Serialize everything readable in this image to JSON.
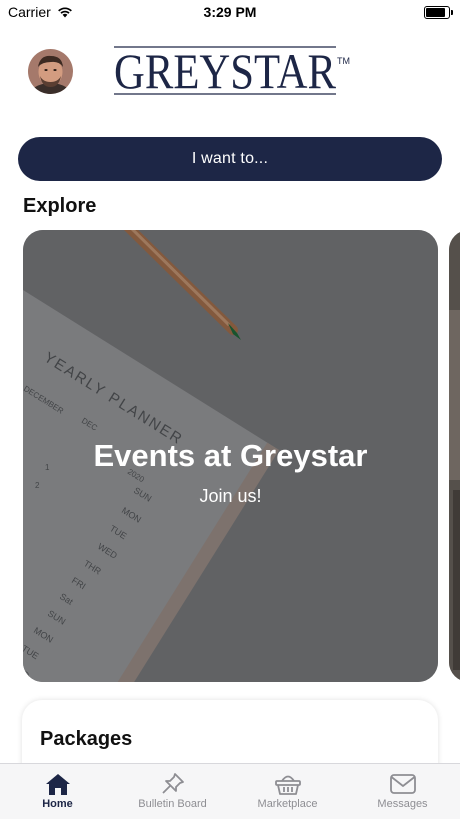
{
  "status_bar": {
    "carrier": "Carrier",
    "time": "3:29 PM",
    "battery_level": 0.95
  },
  "header": {
    "avatar_alt": "user-avatar",
    "logo_text": "GREYSTAR",
    "logo_mark": "TM"
  },
  "actions": {
    "i_want_to": "I want to..."
  },
  "explore": {
    "heading": "Explore",
    "cards": [
      {
        "title": "Events at Greystar",
        "subtitle": "Join us!"
      }
    ],
    "planner_text": {
      "title": "YEARLY PLANNER",
      "year": "2020",
      "months": [
        "DECEMBER",
        "DEC"
      ],
      "days": [
        "SUN",
        "MON",
        "TUE",
        "WED",
        "THR",
        "FRI",
        "Sat",
        "SUN",
        "MON",
        "TUE",
        "WED"
      ],
      "numbers": [
        "1",
        "2",
        "3",
        "4"
      ]
    }
  },
  "packages": {
    "title": "Packages"
  },
  "tabs": [
    {
      "label": "Home",
      "icon": "home-icon",
      "active": true
    },
    {
      "label": "Bulletin Board",
      "icon": "pushpin-icon",
      "active": false
    },
    {
      "label": "Marketplace",
      "icon": "basket-icon",
      "active": false
    },
    {
      "label": "Messages",
      "icon": "envelope-icon",
      "active": false
    }
  ],
  "colors": {
    "brand_navy": "#1d2646",
    "tab_inactive": "#8e8e93"
  }
}
